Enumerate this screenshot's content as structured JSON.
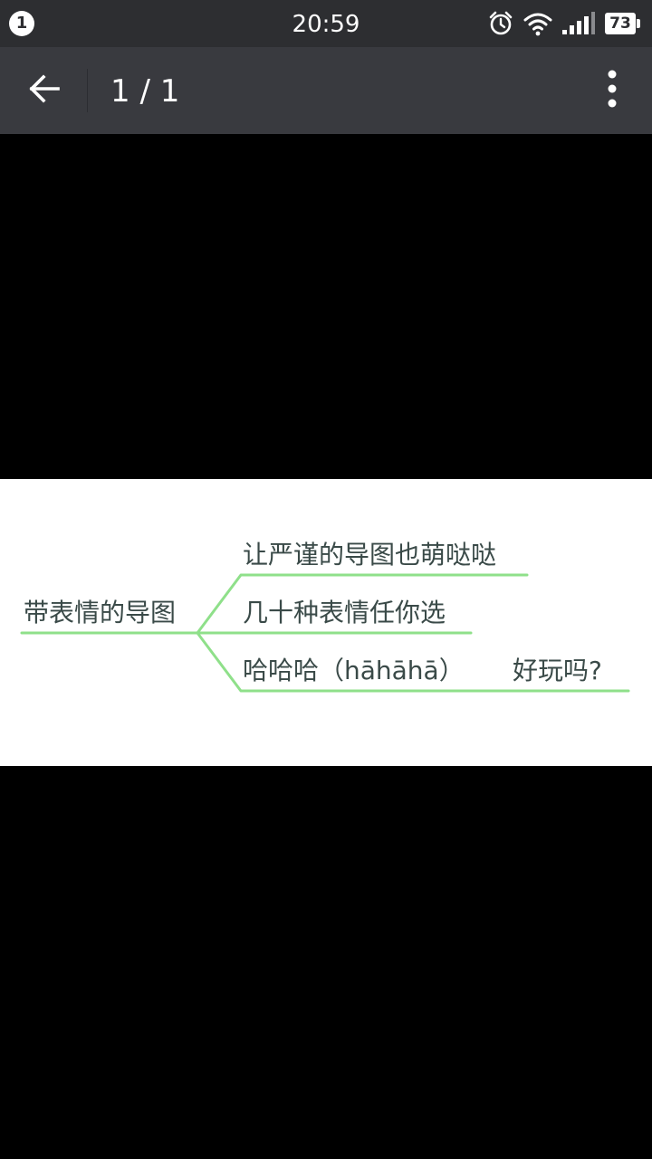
{
  "statusbar": {
    "notification_count": "1",
    "time": "20:59",
    "battery_level": "73",
    "icons": [
      "alarm-icon",
      "wifi-icon",
      "signal-icon",
      "battery-icon"
    ]
  },
  "toolbar": {
    "back_icon": "back-arrow-icon",
    "page_counter": "1 / 1",
    "more_icon": "more-vertical-icon"
  },
  "mindmap": {
    "root": "带表情的导图",
    "branches": [
      {
        "label": "让严谨的导图也萌哒哒"
      },
      {
        "label": "几十种表情任你选"
      },
      {
        "label": "哈哈哈（hāhāhā）",
        "suffix": "好玩吗?"
      }
    ],
    "line_color": "#8fe08a"
  },
  "colors": {
    "statusbar_bg": "#2d2e31",
    "toolbar_bg": "#393a3f",
    "viewer_bg": "#000000",
    "text_dark": "#3a4a48"
  }
}
